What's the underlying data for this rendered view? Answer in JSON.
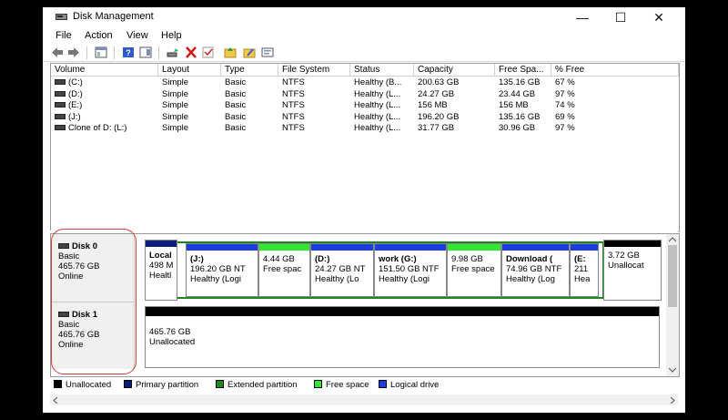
{
  "window": {
    "title": "Disk Management",
    "controls": {
      "minimize": "—",
      "maximize": "☐",
      "close": "✕"
    }
  },
  "menu": [
    "File",
    "Action",
    "View",
    "Help"
  ],
  "volume_list": {
    "headers": [
      "Volume",
      "Layout",
      "Type",
      "File System",
      "Status",
      "Capacity",
      "Free Spa...",
      "% Free"
    ],
    "rows": [
      [
        "(C:)",
        "Simple",
        "Basic",
        "NTFS",
        "Healthy (B...",
        "200.63 GB",
        "135.16 GB",
        "67 %"
      ],
      [
        "(D:)",
        "Simple",
        "Basic",
        "NTFS",
        "Healthy (L...",
        "24.27 GB",
        "23.44 GB",
        "97 %"
      ],
      [
        "(E:)",
        "Simple",
        "Basic",
        "NTFS",
        "Healthy (L...",
        "156 MB",
        "156 MB",
        "74 %"
      ],
      [
        "(J:)",
        "Simple",
        "Basic",
        "NTFS",
        "Healthy (L...",
        "196.20 GB",
        "135.16 GB",
        "69 %"
      ],
      [
        "Clone of D: (L:)",
        "Simple",
        "Basic",
        "NTFS",
        "Healthy (L...",
        "31.77 GB",
        "30.96 GB",
        "97 %"
      ]
    ]
  },
  "disks": [
    {
      "name": "Disk 0",
      "type": "Basic",
      "size": "465.76 GB",
      "state": "Online",
      "partitions": [
        {
          "l1": "Local",
          "l2": "498 M",
          "l3": "Healtl",
          "bold": true
        },
        {
          "l1": "(J:)",
          "l2": "196.20 GB NT",
          "l3": "Healthy (Logi",
          "bold": true
        },
        {
          "l1": "4.44 GB",
          "l2": "Free spac",
          "l3": "",
          "bold": false
        },
        {
          "l1": "(D:)",
          "l2": "24.27 GB NT",
          "l3": "Healthy (Lo",
          "bold": true
        },
        {
          "l1": "work  (G:)",
          "l2": "151.50 GB NTF",
          "l3": "Healthy (Logi",
          "bold": true
        },
        {
          "l1": "9.98 GB",
          "l2": "Free space",
          "l3": "",
          "bold": false
        },
        {
          "l1": "Download  (",
          "l2": "74.96 GB NTF",
          "l3": "Healthy (Log",
          "bold": true
        },
        {
          "l1": "(E:",
          "l2": "211",
          "l3": "Hea",
          "bold": true
        },
        {
          "l1": "3.72 GB",
          "l2": "Unallocat",
          "l3": "",
          "bold": false
        }
      ]
    },
    {
      "name": "Disk 1",
      "type": "Basic",
      "size": "465.76 GB",
      "state": "Online",
      "partitions": [
        {
          "l1": "465.76 GB",
          "l2": "Unallocated",
          "l3": "",
          "bold": false
        }
      ]
    }
  ],
  "legend": [
    "Unallocated",
    "Primary partition",
    "Extended partition",
    "Free space",
    "Logical drive"
  ],
  "colors": {
    "unallocated": "#000000",
    "primary": "#0a1f7a",
    "extended": "#1a8a1a",
    "free": "#33e633",
    "logical": "#1c3ee0",
    "annotation": "#d43b3b"
  }
}
